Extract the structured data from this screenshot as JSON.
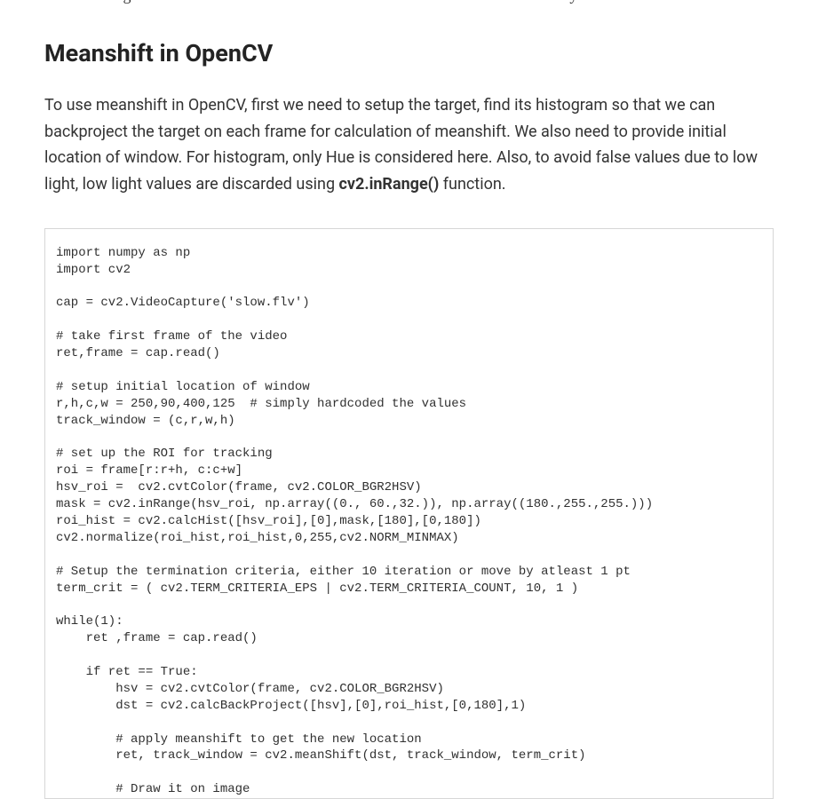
{
  "cutoff_previous_line": "meanshift algorithm moves our window to the new location with maximum density.",
  "heading": "Meanshift in OpenCV",
  "paragraph_pre": "To use meanshift in OpenCV, first we need to setup the target, find its histogram so that we can backproject the target on each frame for calculation of meanshift. We also need to provide initial location of window. For histogram, only Hue is considered here. Also, to avoid false values due to low light, low light values are discarded using ",
  "paragraph_code": "cv2.inRange()",
  "paragraph_post": " function.",
  "code": "import numpy as np\nimport cv2\n\ncap = cv2.VideoCapture('slow.flv')\n\n# take first frame of the video\nret,frame = cap.read()\n\n# setup initial location of window\nr,h,c,w = 250,90,400,125  # simply hardcoded the values\ntrack_window = (c,r,w,h)\n\n# set up the ROI for tracking\nroi = frame[r:r+h, c:c+w]\nhsv_roi =  cv2.cvtColor(frame, cv2.COLOR_BGR2HSV)\nmask = cv2.inRange(hsv_roi, np.array((0., 60.,32.)), np.array((180.,255.,255.)))\nroi_hist = cv2.calcHist([hsv_roi],[0],mask,[180],[0,180])\ncv2.normalize(roi_hist,roi_hist,0,255,cv2.NORM_MINMAX)\n\n# Setup the termination criteria, either 10 iteration or move by atleast 1 pt\nterm_crit = ( cv2.TERM_CRITERIA_EPS | cv2.TERM_CRITERIA_COUNT, 10, 1 )\n\nwhile(1):\n    ret ,frame = cap.read()\n\n    if ret == True:\n        hsv = cv2.cvtColor(frame, cv2.COLOR_BGR2HSV)\n        dst = cv2.calcBackProject([hsv],[0],roi_hist,[0,180],1)\n\n        # apply meanshift to get the new location\n        ret, track_window = cv2.meanShift(dst, track_window, term_crit)\n\n        # Draw it on image"
}
